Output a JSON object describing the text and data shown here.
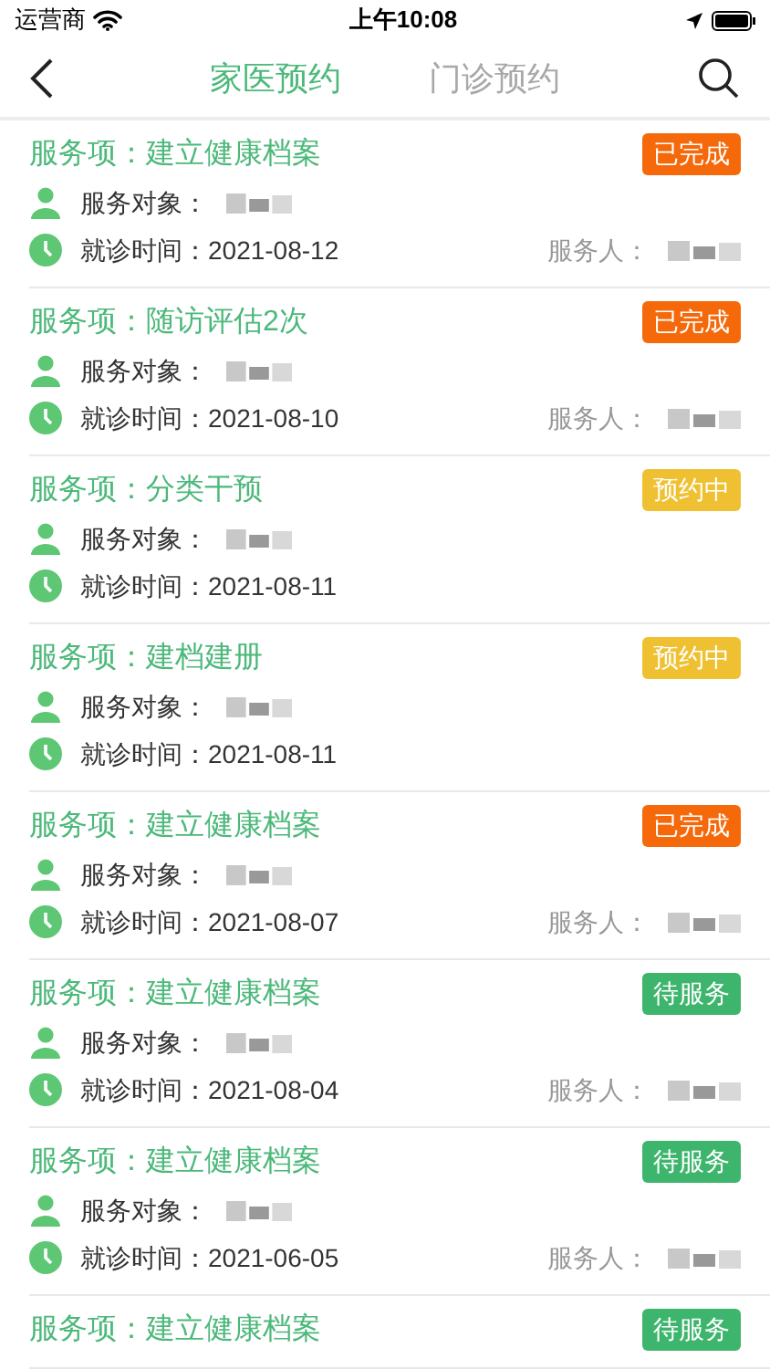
{
  "status_bar": {
    "carrier": "运营商",
    "time": "上午10:08"
  },
  "tabs": [
    {
      "label": "家医预约",
      "selected": true
    },
    {
      "label": "门诊预约",
      "selected": false
    }
  ],
  "appointments": [
    {
      "service": "服务项：建立健康档案",
      "status": {
        "kind": "done",
        "label": "已完成"
      },
      "subject_label": "服务对象：",
      "date": "就诊时间：2021-08-12",
      "staff_label": "服务人："
    },
    {
      "service": "服务项：随访评估2次",
      "status": {
        "kind": "done",
        "label": "已完成"
      },
      "subject_label": "服务对象：",
      "date": "就诊时间：2021-08-10",
      "staff_label": "服务人："
    },
    {
      "service": "服务项：分类干预",
      "status": {
        "kind": "booked",
        "label": "预约中"
      },
      "subject_label": "服务对象：",
      "date": "就诊时间：2021-08-11"
    },
    {
      "service": "服务项：建档建册",
      "status": {
        "kind": "booked",
        "label": "预约中"
      },
      "subject_label": "服务对象：",
      "date": "就诊时间：2021-08-11"
    },
    {
      "service": "服务项：建立健康档案",
      "status": {
        "kind": "done",
        "label": "已完成"
      },
      "subject_label": "服务对象：",
      "date": "就诊时间：2021-08-07",
      "staff_label": "服务人："
    },
    {
      "service": "服务项：建立健康档案",
      "status": {
        "kind": "pending",
        "label": "待服务"
      },
      "subject_label": "服务对象：",
      "date": "就诊时间：2021-08-04",
      "staff_label": "服务人："
    },
    {
      "service": "服务项：建立健康档案",
      "status": {
        "kind": "pending",
        "label": "待服务"
      },
      "subject_label": "服务对象：",
      "date": "就诊时间：2021-06-05",
      "staff_label": "服务人："
    },
    {
      "service": "服务项：建立健康档案",
      "status": {
        "kind": "pending",
        "label": "待服务"
      }
    }
  ]
}
